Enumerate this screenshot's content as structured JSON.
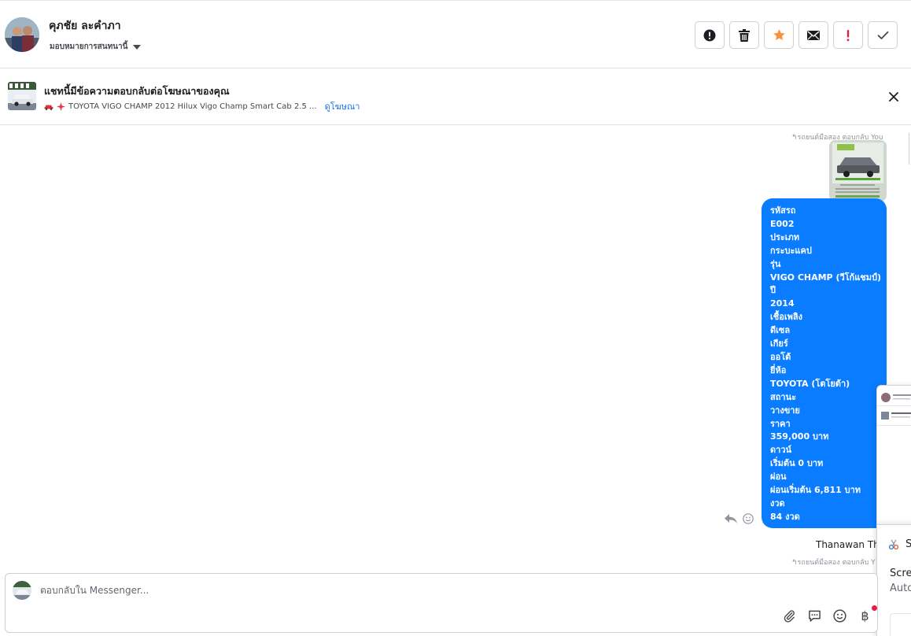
{
  "header": {
    "contact_name": "คุภชัย ละคำภา",
    "assign_label": "มอบหมายการสนทนานี้",
    "actions": [
      {
        "name": "spam-button",
        "icon": "alert-circle-icon",
        "color": "#1c1e21"
      },
      {
        "name": "delete-button",
        "icon": "trash-icon",
        "color": "#1c1e21"
      },
      {
        "name": "star-button",
        "icon": "star-icon",
        "color": "#f7923a"
      },
      {
        "name": "mark-unread-button",
        "icon": "envelope-icon",
        "color": "#1c1e21"
      },
      {
        "name": "follow-up-button",
        "icon": "exclamation-icon",
        "color": "#e41e3f"
      },
      {
        "name": "done-button",
        "icon": "check-icon",
        "color": "#444950"
      }
    ]
  },
  "ad_bar": {
    "title": "แชทนี้มีข้อความตอบกลับต่อโฆษณาของคุณ",
    "subtitle": "TOYOTA VIGO CHAMP 2012 Hilux Vigo Champ Smart Cab 2.5 ...",
    "view_ad_label": "ดูโฆษณา"
  },
  "chat": {
    "reply_note_top": "รถยนต์มือสอง ตอบกลับ You",
    "reply_note_bottom": "รถยนต์มือสอง ตอบกลับ Y",
    "sender_name": "Thanawan Tho",
    "message_lines": [
      "รหัสรถ",
      "E002",
      "ประเภท",
      "กระบะแคป",
      "รุ่น",
      "VIGO CHAMP (วีโก้แชมป์)",
      "ปี",
      "2014",
      "เชื้อเพลิง",
      "ดีเซล",
      "เกียร์",
      "ออโต้",
      "ยี่ห้อ",
      "TOYOTA (โตโยต้า)",
      "สถานะ",
      "วางขาย",
      "ราคา",
      "359,000 บาท",
      "ดาวน์",
      "เริ่มต้น 0 บาท",
      "ผ่อน",
      "ผ่อนเริ่มต้น 6,811 บาท",
      "งวด",
      "84 งวด"
    ],
    "bubble_color": "#0a7cff"
  },
  "floating_window": {
    "line1": "Scree",
    "line2": "Auto"
  },
  "composer": {
    "placeholder": "ตอบกลับใน Messenger...",
    "currency_symbol": "฿"
  }
}
